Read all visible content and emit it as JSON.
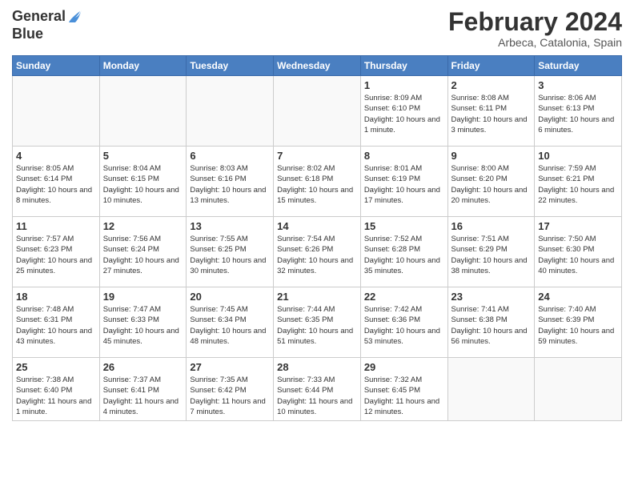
{
  "logo": {
    "line1": "General",
    "line2": "Blue"
  },
  "title": "February 2024",
  "subtitle": "Arbeca, Catalonia, Spain",
  "days_of_week": [
    "Sunday",
    "Monday",
    "Tuesday",
    "Wednesday",
    "Thursday",
    "Friday",
    "Saturday"
  ],
  "weeks": [
    [
      {
        "day": "",
        "info": ""
      },
      {
        "day": "",
        "info": ""
      },
      {
        "day": "",
        "info": ""
      },
      {
        "day": "",
        "info": ""
      },
      {
        "day": "1",
        "info": "Sunrise: 8:09 AM\nSunset: 6:10 PM\nDaylight: 10 hours and 1 minute."
      },
      {
        "day": "2",
        "info": "Sunrise: 8:08 AM\nSunset: 6:11 PM\nDaylight: 10 hours and 3 minutes."
      },
      {
        "day": "3",
        "info": "Sunrise: 8:06 AM\nSunset: 6:13 PM\nDaylight: 10 hours and 6 minutes."
      }
    ],
    [
      {
        "day": "4",
        "info": "Sunrise: 8:05 AM\nSunset: 6:14 PM\nDaylight: 10 hours and 8 minutes."
      },
      {
        "day": "5",
        "info": "Sunrise: 8:04 AM\nSunset: 6:15 PM\nDaylight: 10 hours and 10 minutes."
      },
      {
        "day": "6",
        "info": "Sunrise: 8:03 AM\nSunset: 6:16 PM\nDaylight: 10 hours and 13 minutes."
      },
      {
        "day": "7",
        "info": "Sunrise: 8:02 AM\nSunset: 6:18 PM\nDaylight: 10 hours and 15 minutes."
      },
      {
        "day": "8",
        "info": "Sunrise: 8:01 AM\nSunset: 6:19 PM\nDaylight: 10 hours and 17 minutes."
      },
      {
        "day": "9",
        "info": "Sunrise: 8:00 AM\nSunset: 6:20 PM\nDaylight: 10 hours and 20 minutes."
      },
      {
        "day": "10",
        "info": "Sunrise: 7:59 AM\nSunset: 6:21 PM\nDaylight: 10 hours and 22 minutes."
      }
    ],
    [
      {
        "day": "11",
        "info": "Sunrise: 7:57 AM\nSunset: 6:23 PM\nDaylight: 10 hours and 25 minutes."
      },
      {
        "day": "12",
        "info": "Sunrise: 7:56 AM\nSunset: 6:24 PM\nDaylight: 10 hours and 27 minutes."
      },
      {
        "day": "13",
        "info": "Sunrise: 7:55 AM\nSunset: 6:25 PM\nDaylight: 10 hours and 30 minutes."
      },
      {
        "day": "14",
        "info": "Sunrise: 7:54 AM\nSunset: 6:26 PM\nDaylight: 10 hours and 32 minutes."
      },
      {
        "day": "15",
        "info": "Sunrise: 7:52 AM\nSunset: 6:28 PM\nDaylight: 10 hours and 35 minutes."
      },
      {
        "day": "16",
        "info": "Sunrise: 7:51 AM\nSunset: 6:29 PM\nDaylight: 10 hours and 38 minutes."
      },
      {
        "day": "17",
        "info": "Sunrise: 7:50 AM\nSunset: 6:30 PM\nDaylight: 10 hours and 40 minutes."
      }
    ],
    [
      {
        "day": "18",
        "info": "Sunrise: 7:48 AM\nSunset: 6:31 PM\nDaylight: 10 hours and 43 minutes."
      },
      {
        "day": "19",
        "info": "Sunrise: 7:47 AM\nSunset: 6:33 PM\nDaylight: 10 hours and 45 minutes."
      },
      {
        "day": "20",
        "info": "Sunrise: 7:45 AM\nSunset: 6:34 PM\nDaylight: 10 hours and 48 minutes."
      },
      {
        "day": "21",
        "info": "Sunrise: 7:44 AM\nSunset: 6:35 PM\nDaylight: 10 hours and 51 minutes."
      },
      {
        "day": "22",
        "info": "Sunrise: 7:42 AM\nSunset: 6:36 PM\nDaylight: 10 hours and 53 minutes."
      },
      {
        "day": "23",
        "info": "Sunrise: 7:41 AM\nSunset: 6:38 PM\nDaylight: 10 hours and 56 minutes."
      },
      {
        "day": "24",
        "info": "Sunrise: 7:40 AM\nSunset: 6:39 PM\nDaylight: 10 hours and 59 minutes."
      }
    ],
    [
      {
        "day": "25",
        "info": "Sunrise: 7:38 AM\nSunset: 6:40 PM\nDaylight: 11 hours and 1 minute."
      },
      {
        "day": "26",
        "info": "Sunrise: 7:37 AM\nSunset: 6:41 PM\nDaylight: 11 hours and 4 minutes."
      },
      {
        "day": "27",
        "info": "Sunrise: 7:35 AM\nSunset: 6:42 PM\nDaylight: 11 hours and 7 minutes."
      },
      {
        "day": "28",
        "info": "Sunrise: 7:33 AM\nSunset: 6:44 PM\nDaylight: 11 hours and 10 minutes."
      },
      {
        "day": "29",
        "info": "Sunrise: 7:32 AM\nSunset: 6:45 PM\nDaylight: 11 hours and 12 minutes."
      },
      {
        "day": "",
        "info": ""
      },
      {
        "day": "",
        "info": ""
      }
    ]
  ]
}
